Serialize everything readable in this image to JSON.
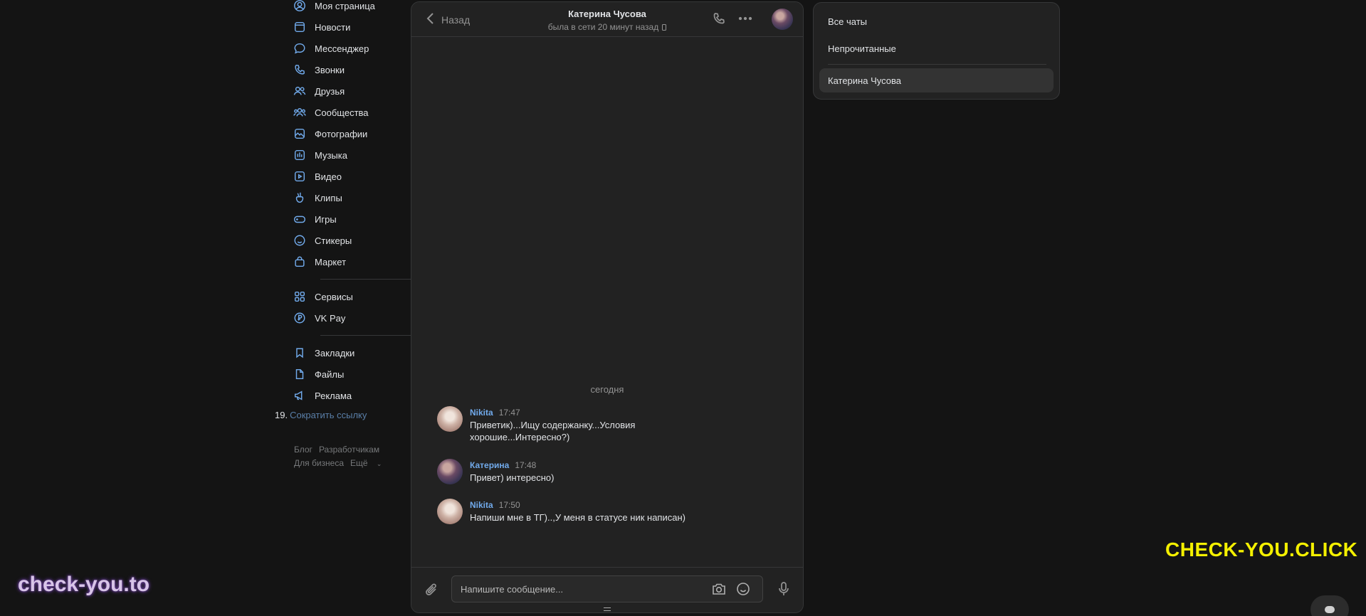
{
  "nav": {
    "items": [
      {
        "label": "Моя страница",
        "icon": "user-circle-icon"
      },
      {
        "label": "Новости",
        "icon": "newspaper-icon"
      },
      {
        "label": "Мессенджер",
        "icon": "chat-bubble-icon"
      },
      {
        "label": "Звонки",
        "icon": "phone-icon"
      },
      {
        "label": "Друзья",
        "icon": "friends-icon"
      },
      {
        "label": "Сообщества",
        "icon": "communities-icon"
      },
      {
        "label": "Фотографии",
        "icon": "photo-icon"
      },
      {
        "label": "Музыка",
        "icon": "music-icon"
      },
      {
        "label": "Видео",
        "icon": "video-icon"
      },
      {
        "label": "Клипы",
        "icon": "clips-icon"
      },
      {
        "label": "Игры",
        "icon": "gamepad-icon"
      },
      {
        "label": "Стикеры",
        "icon": "smile-icon"
      },
      {
        "label": "Маркет",
        "icon": "shopping-bag-icon"
      },
      {
        "label": "Сервисы",
        "icon": "grid-icon"
      },
      {
        "label": "VK Pay",
        "icon": "vkpay-icon"
      },
      {
        "label": "Закладки",
        "icon": "bookmark-icon"
      },
      {
        "label": "Файлы",
        "icon": "file-icon"
      },
      {
        "label": "Реклама",
        "icon": "megaphone-icon"
      }
    ],
    "shorten_number": "19.",
    "shorten_link": "Сократить ссылку",
    "footer": {
      "blog": "Блог",
      "developers": "Разработчикам",
      "business": "Для бизнеса",
      "more": "Ещё"
    }
  },
  "chat": {
    "back_label": "Назад",
    "peer_name": "Катерина Чусова",
    "peer_status": "была в сети 20 минут назад",
    "date_separator": "сегодня",
    "messages": [
      {
        "author": "Nikita",
        "time": "17:47",
        "text": "Приветик)...Ищу содержанку...Условия хорошие...Интересно?)"
      },
      {
        "author": "Катерина",
        "time": "17:48",
        "text": "Привет) интересно)"
      },
      {
        "author": "Nikita",
        "time": "17:50",
        "text": "Напиши мне в ТГ)..,У меня в статусе ник написан)"
      }
    ],
    "composer_placeholder": "Напишите сообщение..."
  },
  "folders": {
    "all": "Все чаты",
    "unread": "Непрочитанные",
    "pinned": "Катерина Чусова"
  },
  "watermarks": {
    "right": "CHECK-YOU.CLICK",
    "left": "check-you.to"
  },
  "colors": {
    "accent": "#71aaeb",
    "background": "#141414",
    "panel": "#222222",
    "watermark_yellow": "#f4f000"
  }
}
